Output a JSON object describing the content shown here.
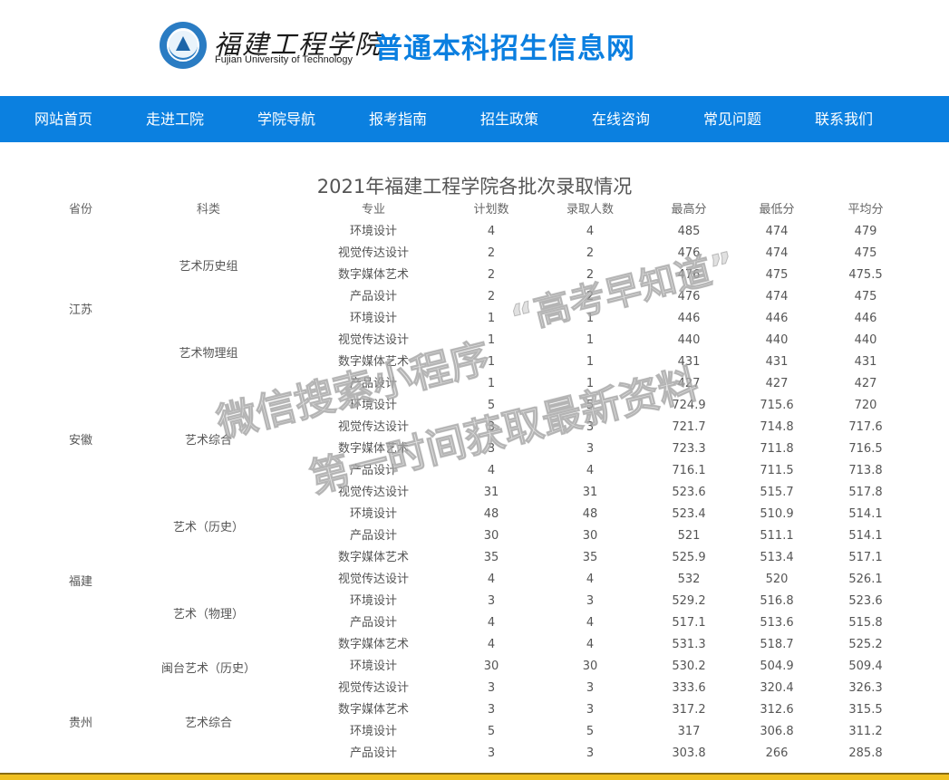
{
  "header": {
    "logo_cn": "福建工程学院",
    "logo_en": "Fujian University of Technology",
    "site_title": "普通本科招生信息网"
  },
  "nav": [
    "网站首页",
    "走进工院",
    "学院导航",
    "报考指南",
    "招生政策",
    "在线咨询",
    "常见问题",
    "联系我们"
  ],
  "page_title": "2021年福建工程学院各批次录取情况",
  "table": {
    "headers": [
      "省份",
      "科类",
      "专业",
      "计划数",
      "录取人数",
      "最高分",
      "最低分",
      "平均分"
    ],
    "rows": [
      [
        "环境设计",
        "4",
        "4",
        "485",
        "474",
        "479"
      ],
      [
        "视觉传达设计",
        "2",
        "2",
        "476",
        "474",
        "475"
      ],
      [
        "数字媒体艺术",
        "2",
        "2",
        "476",
        "475",
        "475.5"
      ],
      [
        "产品设计",
        "2",
        "2",
        "476",
        "474",
        "475"
      ],
      [
        "环境设计",
        "1",
        "1",
        "446",
        "446",
        "446"
      ],
      [
        "视觉传达设计",
        "1",
        "1",
        "440",
        "440",
        "440"
      ],
      [
        "数字媒体艺术",
        "1",
        "1",
        "431",
        "431",
        "431"
      ],
      [
        "产品设计",
        "1",
        "1",
        "427",
        "427",
        "427"
      ],
      [
        "环境设计",
        "5",
        "5",
        "724.9",
        "715.6",
        "720"
      ],
      [
        "视觉传达设计",
        "3",
        "3",
        "721.7",
        "714.8",
        "717.6"
      ],
      [
        "数字媒体艺术",
        "3",
        "3",
        "723.3",
        "711.8",
        "716.5"
      ],
      [
        "产品设计",
        "4",
        "4",
        "716.1",
        "711.5",
        "713.8"
      ],
      [
        "视觉传达设计",
        "31",
        "31",
        "523.6",
        "515.7",
        "517.8"
      ],
      [
        "环境设计",
        "48",
        "48",
        "523.4",
        "510.9",
        "514.1"
      ],
      [
        "产品设计",
        "30",
        "30",
        "521",
        "511.1",
        "514.1"
      ],
      [
        "数字媒体艺术",
        "35",
        "35",
        "525.9",
        "513.4",
        "517.1"
      ],
      [
        "视觉传达设计",
        "4",
        "4",
        "532",
        "520",
        "526.1"
      ],
      [
        "环境设计",
        "3",
        "3",
        "529.2",
        "516.8",
        "523.6"
      ],
      [
        "产品设计",
        "4",
        "4",
        "517.1",
        "513.6",
        "515.8"
      ],
      [
        "数字媒体艺术",
        "4",
        "4",
        "531.3",
        "518.7",
        "525.2"
      ],
      [
        "环境设计",
        "30",
        "30",
        "530.2",
        "504.9",
        "509.4"
      ],
      [
        "视觉传达设计",
        "3",
        "3",
        "333.6",
        "320.4",
        "326.3"
      ],
      [
        "数字媒体艺术",
        "3",
        "3",
        "317.2",
        "312.6",
        "315.5"
      ],
      [
        "环境设计",
        "5",
        "5",
        "317",
        "306.8",
        "311.2"
      ],
      [
        "产品设计",
        "3",
        "3",
        "303.8",
        "266",
        "285.8"
      ]
    ],
    "provinces": [
      {
        "name": "江苏",
        "start": 0,
        "span": 8
      },
      {
        "name": "安徽",
        "start": 8,
        "span": 4
      },
      {
        "name": "福建",
        "start": 12,
        "span": 9
      },
      {
        "name": "贵州",
        "start": 21,
        "span": 4
      }
    ],
    "categories": [
      {
        "name": "艺术历史组",
        "start": 0,
        "span": 4
      },
      {
        "name": "艺术物理组",
        "start": 4,
        "span": 4
      },
      {
        "name": "艺术综合",
        "start": 8,
        "span": 4
      },
      {
        "name": "艺术（历史）",
        "start": 12,
        "span": 4
      },
      {
        "name": "艺术（物理）",
        "start": 16,
        "span": 4
      },
      {
        "name": "闽台艺术（历史）",
        "start": 20,
        "span": 1
      },
      {
        "name": "艺术综合",
        "start": 21,
        "span": 4
      }
    ]
  },
  "watermark": {
    "line1": "“高考早知道”",
    "line2": "微信搜索小程序",
    "line3": "第一时间获取最新资料"
  },
  "colors": {
    "brand_blue": "#0b80e0",
    "footer_gold": "#f0c020"
  }
}
